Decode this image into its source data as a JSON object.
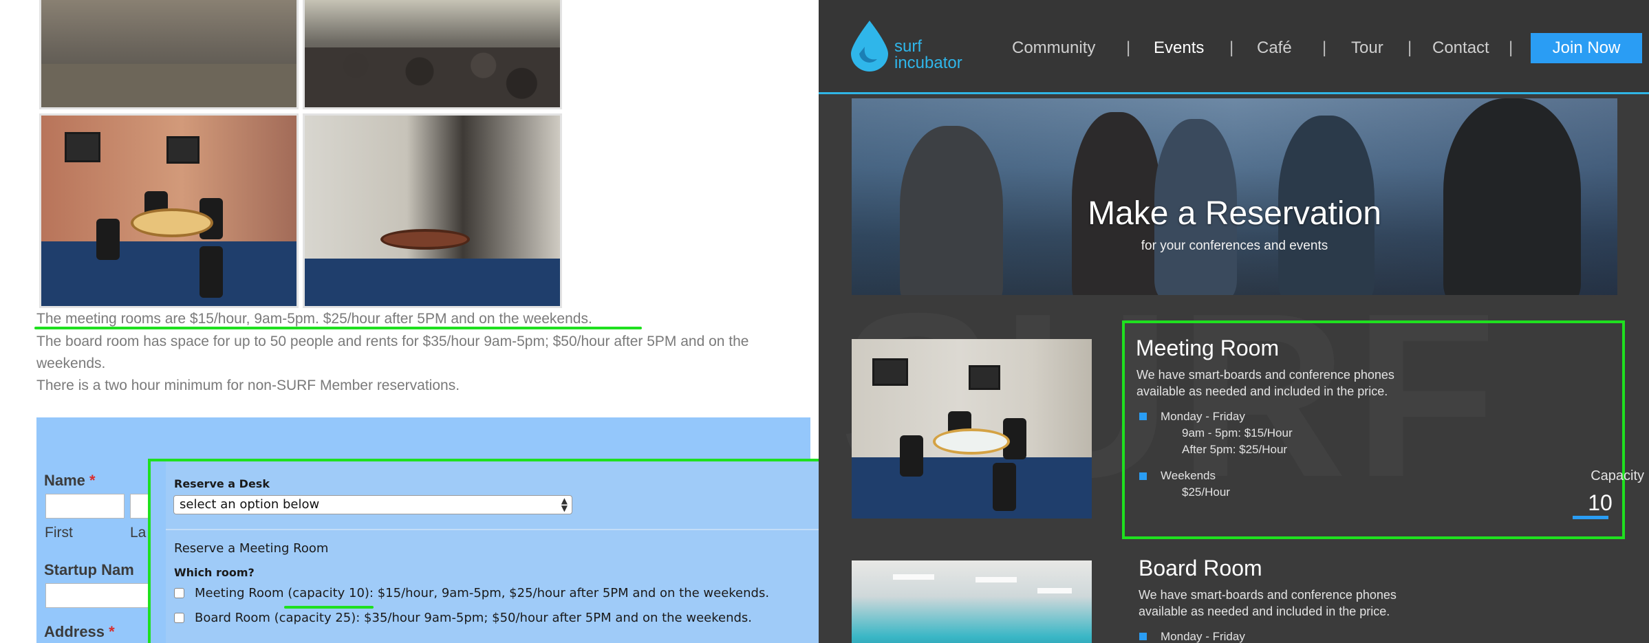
{
  "left": {
    "info": {
      "line1": "The meeting rooms are $15/hour, 9am-5pm. $25/hour after 5PM and on the weekends.",
      "line2": "The board room has space for up to 50 people and rents for $35/hour 9am-5pm; $50/hour after 5PM and on the",
      "line3": "weekends.",
      "line4": "There is a two hour minimum for non-SURF Member reservations."
    },
    "form": {
      "name_label": "Name",
      "required_mark": "*",
      "first_label": "First",
      "last_label": "La",
      "startup_label": "Startup Nam",
      "address_label": "Address",
      "desk_label": "Reserve a Desk",
      "desk_select": "select an option below",
      "meeting_heading": "Reserve a Meeting Room",
      "which_room": "Which room?",
      "option_meeting": "Meeting Room (capacity 10): $15/hour, 9am-5pm, $25/hour after 5PM and on the weekends.",
      "option_board": "Board Room (capacity 25): $35/hour 9am-5pm; $50/hour after 5PM and on the weekends."
    }
  },
  "right": {
    "logo": {
      "line1": "surf",
      "line2": "incubator"
    },
    "nav": [
      "Community",
      "Events",
      "Café",
      "Tour",
      "Contact"
    ],
    "nav_separator": "|",
    "join_label": "Join Now",
    "hero": {
      "title": "Make a Reservation",
      "subtitle": "for your conferences and events"
    },
    "watermark": "SURF",
    "meeting_room": {
      "title": "Meeting Room",
      "desc": "We have smart-boards and conference phones available as needed and included in the price.",
      "weekday": "Monday - Friday",
      "weekday_rate1": "9am - 5pm: $15/Hour",
      "weekday_rate2": "After 5pm:  $25/Hour",
      "weekend": "Weekends",
      "weekend_rate": "$25/Hour",
      "capacity_label": "Capacity",
      "capacity_value": "10"
    },
    "board_room": {
      "title": "Board Room",
      "desc": "We have smart-boards and conference phones available as needed and included in the price.",
      "weekday": "Monday - Friday"
    }
  },
  "colors": {
    "highlight": "#1fe01f",
    "accent_blue": "#2a9df4",
    "nav_underline": "#30b6e6",
    "form_blue": "#94c7fb"
  }
}
